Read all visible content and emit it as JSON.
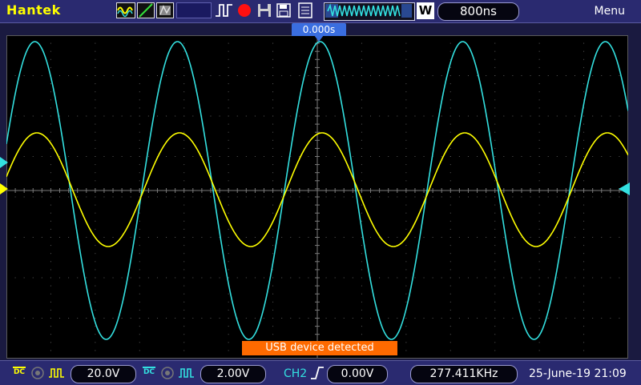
{
  "header": {
    "brand": "Hantek",
    "timebase": "800ns",
    "menu_label": "Menu",
    "w_label": "W",
    "trigger_position": "0.000s"
  },
  "message": "USB device detected",
  "footer": {
    "ch1_coupling": "DC",
    "ch1_scale": "20.0V",
    "ch2_coupling": "DC",
    "ch2_scale": "2.00V",
    "trigger_source": "CH2",
    "trigger_level": "0.00V",
    "frequency": "277.411KHz",
    "datetime": "25-June-19 21:09"
  },
  "colors": {
    "ch1": "#ffff00",
    "ch2": "#33e0e0",
    "accent": "#3a6ee0",
    "message": "#ff6a00"
  }
}
